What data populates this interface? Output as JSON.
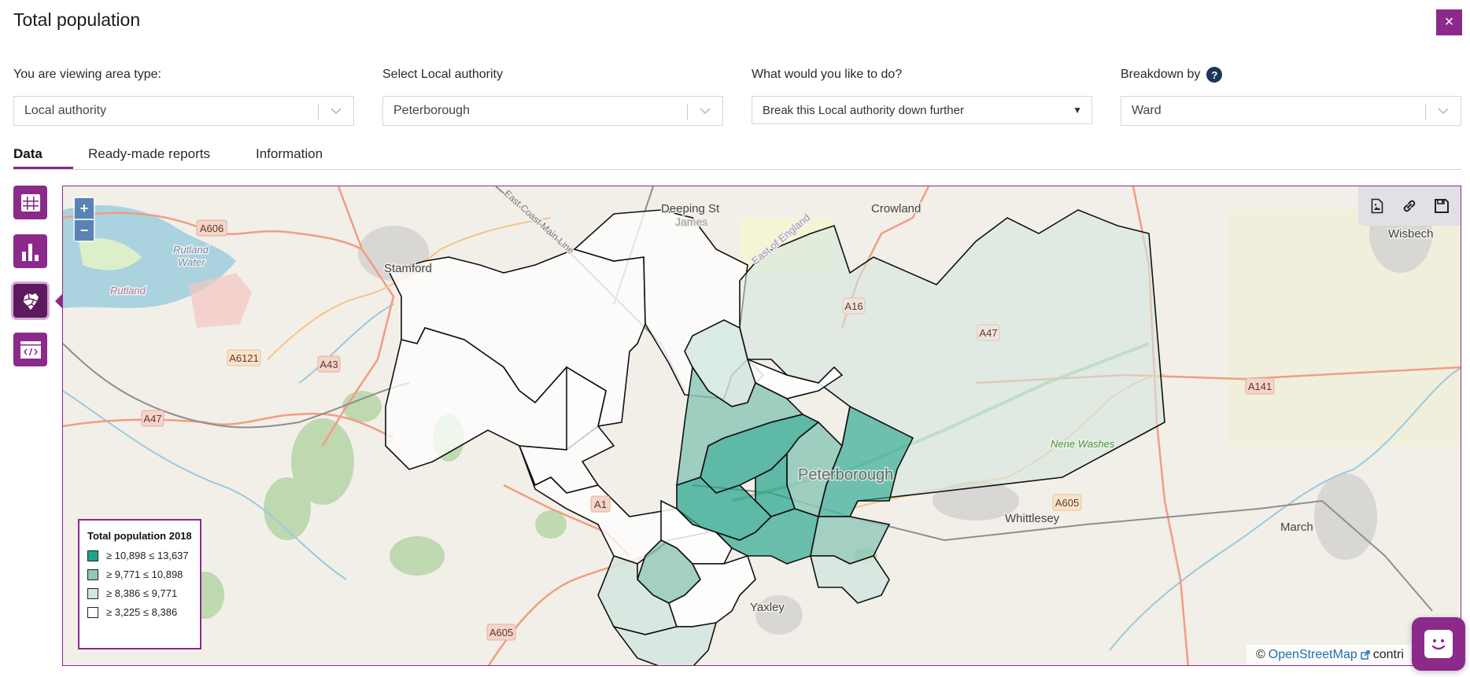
{
  "header": {
    "title": "Total population",
    "close_label": "×"
  },
  "filters": {
    "area_type": {
      "label": "You are viewing area type:",
      "value": "Local authority"
    },
    "local_authority": {
      "label": "Select Local authority",
      "value": "Peterborough"
    },
    "action": {
      "label": "What would you like to do?",
      "value": "Break this Local authority down further"
    },
    "breakdown": {
      "label": "Breakdown by",
      "value": "Ward",
      "help": "?"
    }
  },
  "tabs": [
    {
      "label": "Data",
      "active": true
    },
    {
      "label": "Ready-made reports",
      "active": false
    },
    {
      "label": "Information",
      "active": false
    }
  ],
  "view_switcher": [
    {
      "name": "table-view",
      "active": false
    },
    {
      "name": "chart-view",
      "active": false
    },
    {
      "name": "map-view",
      "active": true
    },
    {
      "name": "embed-view",
      "active": false
    }
  ],
  "map": {
    "zoom_in": "+",
    "zoom_out": "−",
    "tools": [
      "export-image",
      "share-link",
      "save"
    ],
    "place_labels": {
      "stamford": "Stamford",
      "deeping": "Deeping St",
      "james": "James",
      "crowland": "Crowland",
      "wisbech": "Wisbech",
      "rutland_water_1": "Rutland",
      "rutland_water_2": "Water",
      "rutland": "Rutland",
      "peterborough": "Peterborough",
      "whittlesey": "Whittlesey",
      "march": "March",
      "yaxley": "Yaxley",
      "nene_washes": "Nene Washes",
      "east_of_england": "East of England",
      "east_coast": "East Coast Main Line"
    },
    "road_labels": {
      "a606": "A606",
      "a6121": "A6121",
      "a43": "A43",
      "a47_w": "A47",
      "a16": "A16",
      "a47_e": "A47",
      "a141": "A141",
      "a1": "A1",
      "a605_w": "A605",
      "a605_e": "A605"
    },
    "legend": {
      "title": "Total population 2018",
      "classes": [
        {
          "label": "≥ 10,898 ≤ 13,637",
          "color": "#1fa38a"
        },
        {
          "label": "≥ 9,771 ≤ 10,898",
          "color": "#8ec8b8"
        },
        {
          "label": "≥ 8,386 ≤ 9,771",
          "color": "#d4e6df"
        },
        {
          "label": "≥ 3,225 ≤ 8,386",
          "color": "#ffffff"
        }
      ]
    },
    "attribution": {
      "prefix": "©",
      "link": "OpenStreetMap",
      "suffix": "contri"
    }
  },
  "colors": {
    "accent": "#8b2a8b",
    "accent_dark": "#5e1a5e",
    "help_icon": "#1d3557",
    "zoom_button": "#5b82b4"
  }
}
